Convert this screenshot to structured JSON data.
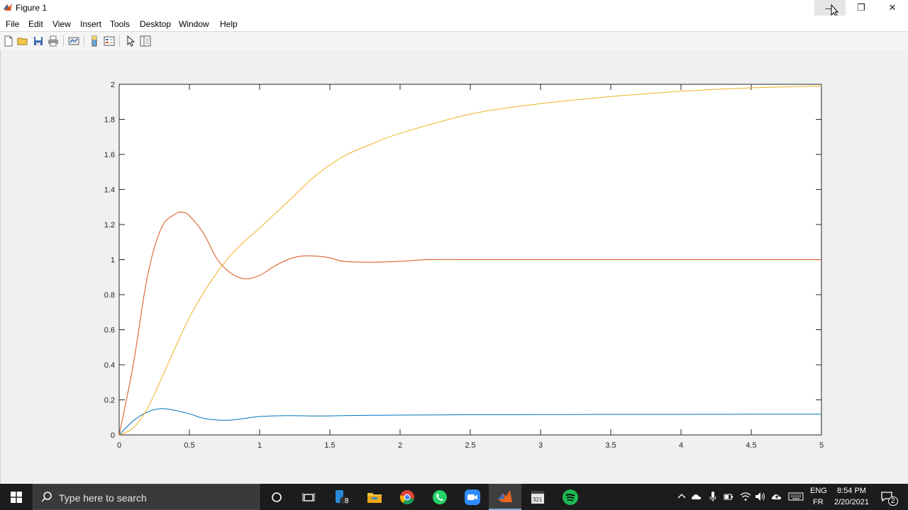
{
  "window": {
    "title": "Figure 1",
    "controls": {
      "minimize": "—",
      "restore": "❐",
      "close": "✕"
    }
  },
  "menu": [
    "File",
    "Edit",
    "View",
    "Insert",
    "Tools",
    "Desktop",
    "Window",
    "Help"
  ],
  "toolbar": {
    "icons": [
      "new-figure-icon",
      "open-file-icon",
      "save-icon",
      "print-icon",
      "link-plot-icon",
      "colorbar-icon",
      "legend-icon",
      "edit-plot-pointer-icon",
      "property-inspector-icon"
    ]
  },
  "chart_data": {
    "type": "line",
    "title": "",
    "xlabel": "",
    "ylabel": "",
    "xlim": [
      0,
      5
    ],
    "ylim": [
      0,
      2
    ],
    "xticks": [
      "0",
      "0.5",
      "1",
      "1.5",
      "2",
      "2.5",
      "3",
      "3.5",
      "4",
      "4.5",
      "5"
    ],
    "yticks": [
      "0",
      "0.2",
      "0.4",
      "0.6",
      "0.8",
      "1",
      "1.2",
      "1.4",
      "1.6",
      "1.8",
      "2"
    ],
    "grid": false,
    "series": [
      {
        "color": "#0072BD",
        "x": [
          0,
          0.1,
          0.2,
          0.3,
          0.4,
          0.5,
          0.6,
          0.7,
          0.8,
          0.9,
          1.0,
          1.2,
          1.4,
          1.6,
          1.8,
          2.0,
          2.5,
          3.0,
          3.5,
          4.0,
          4.5,
          5.0
        ],
        "y": [
          0,
          0.08,
          0.13,
          0.15,
          0.14,
          0.12,
          0.095,
          0.085,
          0.085,
          0.095,
          0.105,
          0.11,
          0.108,
          0.11,
          0.112,
          0.113,
          0.115,
          0.116,
          0.117,
          0.117,
          0.118,
          0.118
        ]
      },
      {
        "color": "#D95319",
        "x": [
          0,
          0.1,
          0.2,
          0.3,
          0.4,
          0.45,
          0.5,
          0.6,
          0.7,
          0.8,
          0.9,
          1.0,
          1.1,
          1.2,
          1.3,
          1.4,
          1.5,
          1.6,
          1.8,
          2.0,
          2.2,
          2.5,
          3.0,
          4.0,
          5.0
        ],
        "y": [
          0,
          0.4,
          0.9,
          1.18,
          1.26,
          1.27,
          1.25,
          1.15,
          1.0,
          0.92,
          0.89,
          0.91,
          0.96,
          1.0,
          1.02,
          1.02,
          1.01,
          0.99,
          0.985,
          0.99,
          1.0,
          1.0,
          1.0,
          1.0,
          1.0
        ]
      },
      {
        "color": "#EDB120",
        "x": [
          0,
          0.1,
          0.2,
          0.3,
          0.4,
          0.5,
          0.6,
          0.7,
          0.8,
          0.9,
          1.0,
          1.2,
          1.4,
          1.6,
          1.8,
          2.0,
          2.5,
          3.0,
          3.5,
          4.0,
          4.5,
          5.0
        ],
        "y": [
          0,
          0.04,
          0.15,
          0.32,
          0.5,
          0.67,
          0.81,
          0.93,
          1.03,
          1.11,
          1.18,
          1.33,
          1.48,
          1.59,
          1.66,
          1.72,
          1.83,
          1.89,
          1.93,
          1.96,
          1.98,
          1.99
        ]
      }
    ]
  },
  "taskbar": {
    "search_placeholder": "Type here to search",
    "apps": [
      "cortana-icon",
      "task-view-icon",
      "phone-link-icon",
      "file-explorer-icon",
      "chrome-icon",
      "whatsapp-icon",
      "zoom-icon",
      "matlab-icon",
      "media-app-icon",
      "spotify-icon"
    ],
    "phone_badge": "8",
    "language_top": "ENG",
    "language_bottom": "FR",
    "time": "8:54 PM",
    "date": "2/20/2021",
    "notification_count": "2",
    "colors": {
      "bar": "#1c1c1c",
      "active": "#3e3e3e"
    }
  }
}
